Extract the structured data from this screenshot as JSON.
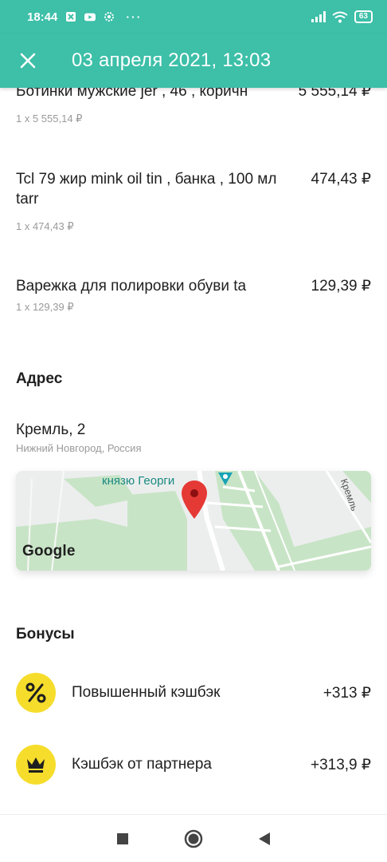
{
  "status_bar": {
    "time": "18:44",
    "battery": "63",
    "dots": "···"
  },
  "header": {
    "title": "03 апреля 2021, 13:03"
  },
  "items": [
    {
      "name": "Ботинки мужские jer , 46 , коричн",
      "price": "5 555,14 ₽",
      "qty": "1 x 5 555,14 ₽"
    },
    {
      "name": "Tcl 79 жир mink oil tin , банка , 100 мл tarr",
      "price": "474,43 ₽",
      "qty": "1 x 474,43 ₽"
    },
    {
      "name": "Варежка для полировки обуви ta",
      "price": "129,39 ₽",
      "qty": "1 x 129,39 ₽"
    }
  ],
  "address": {
    "title": "Адрес",
    "street": "Кремль, 2",
    "city": "Нижний Новгород, Россия",
    "map": {
      "label_poi": "князю Георги",
      "label_street": "Кремль",
      "logo": "Google"
    }
  },
  "bonuses": {
    "title": "Бонусы",
    "rows": [
      {
        "icon": "percent-icon",
        "label": "Повышенный кэшбэк",
        "amount": "+313 ₽"
      },
      {
        "icon": "crown-icon",
        "label": "Кэшбэк от партнера",
        "amount": "+313,9 ₽"
      }
    ]
  },
  "colors": {
    "accent": "#3dbfa8",
    "bonus_icon_bg": "#f6dd2b"
  }
}
